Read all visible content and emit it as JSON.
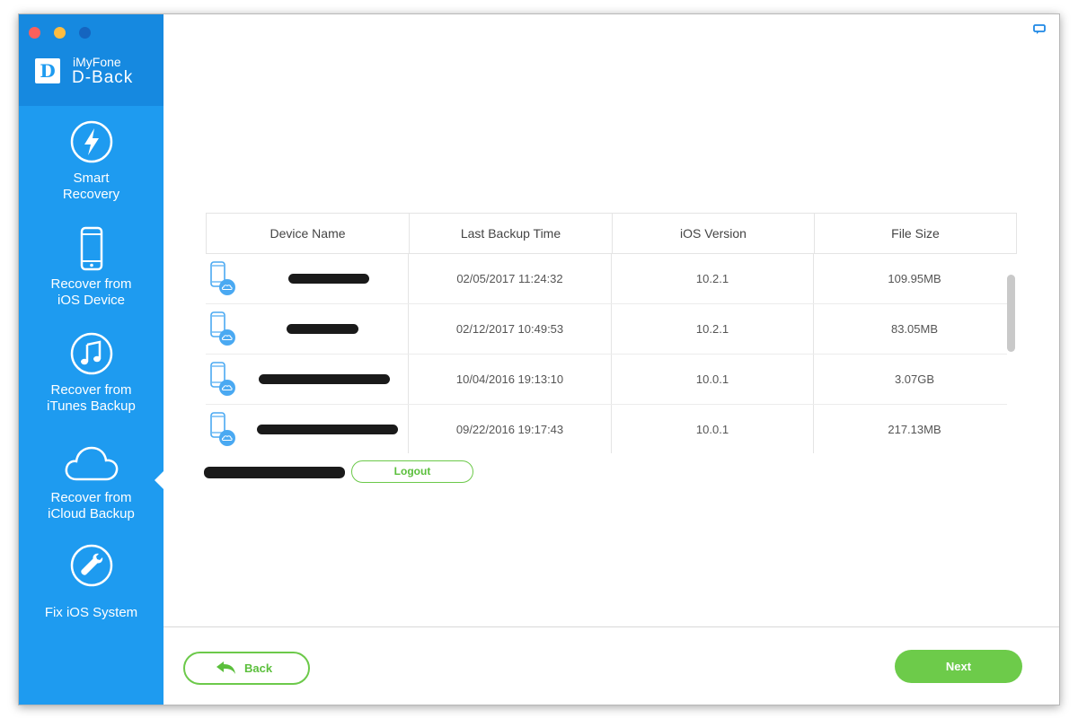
{
  "app": {
    "brand_line1": "iMyFone",
    "brand_line2": "D-Back",
    "logo_letter": "D"
  },
  "sidebar": {
    "items": [
      {
        "label_line1": "Smart",
        "label_line2": "Recovery",
        "icon": "lightning-icon"
      },
      {
        "label_line1": "Recover from",
        "label_line2": "iOS Device",
        "icon": "iphone-icon"
      },
      {
        "label_line1": "Recover from",
        "label_line2": "iTunes Backup",
        "icon": "music-note-icon"
      },
      {
        "label_line1": "Recover from",
        "label_line2": "iCloud Backup",
        "icon": "cloud-icon",
        "active": true
      },
      {
        "label_line1": "Fix iOS System",
        "label_line2": "",
        "icon": "wrench-icon"
      }
    ]
  },
  "table": {
    "headers": [
      "Device Name",
      "Last Backup Time",
      "iOS Version",
      "File Size"
    ],
    "rows": [
      {
        "device_name": "",
        "backup_time": "02/05/2017 11:24:32",
        "ios_version": "10.2.1",
        "file_size": "109.95MB"
      },
      {
        "device_name": "",
        "backup_time": "02/12/2017 10:49:53",
        "ios_version": "10.2.1",
        "file_size": "83.05MB"
      },
      {
        "device_name": "",
        "backup_time": "10/04/2016 19:13:10",
        "ios_version": "10.0.1",
        "file_size": "3.07GB"
      },
      {
        "device_name": "",
        "backup_time": "09/22/2016 19:17:43",
        "ios_version": "10.0.1",
        "file_size": "217.13MB"
      }
    ]
  },
  "account": {
    "logout_label": "Logout"
  },
  "footer": {
    "back_label": "Back",
    "next_label": "Next"
  },
  "colors": {
    "sidebar_bg": "#1e9bf0",
    "sidebar_header_bg": "#1689e0",
    "accent_green": "#6dcb4a",
    "device_icon_blue": "#4aa9f2"
  }
}
